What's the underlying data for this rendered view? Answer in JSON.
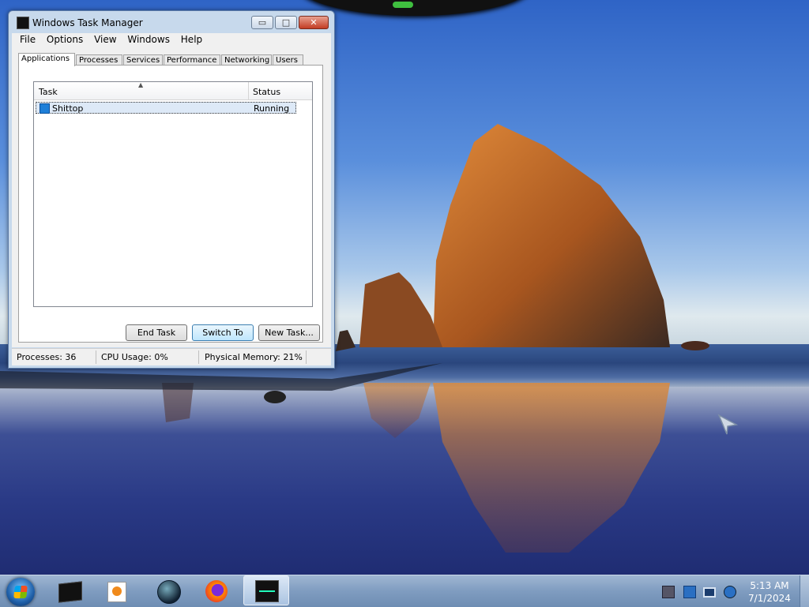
{
  "window": {
    "title": "Windows Task Manager",
    "controls": {
      "minimize": "▭",
      "maximize": "□",
      "close": "✕"
    }
  },
  "menu": [
    "File",
    "Options",
    "View",
    "Windows",
    "Help"
  ],
  "tabs": [
    "Applications",
    "Processes",
    "Services",
    "Performance",
    "Networking",
    "Users"
  ],
  "active_tab": "Applications",
  "task_list": {
    "columns": [
      "Task",
      "Status"
    ],
    "rows": [
      {
        "task": "Shittop",
        "status": "Running"
      }
    ]
  },
  "buttons": {
    "end_task": "End Task",
    "switch_to": "Switch To",
    "new_task": "New Task..."
  },
  "status_bar": {
    "processes": "Processes: 36",
    "cpu": "CPU Usage: 0%",
    "memory": "Physical Memory: 21%"
  },
  "taskbar": {
    "pinned": [
      "command-prompt-icon",
      "media-player-icon",
      "globe-icon",
      "firefox-icon",
      "task-manager-icon"
    ],
    "clock_time": "5:13 AM",
    "clock_date": "7/1/2024"
  },
  "colors": {
    "window_frame": "#c7d9ec",
    "taskbar": "#7f9cc0",
    "selection": "#dde9f7"
  }
}
